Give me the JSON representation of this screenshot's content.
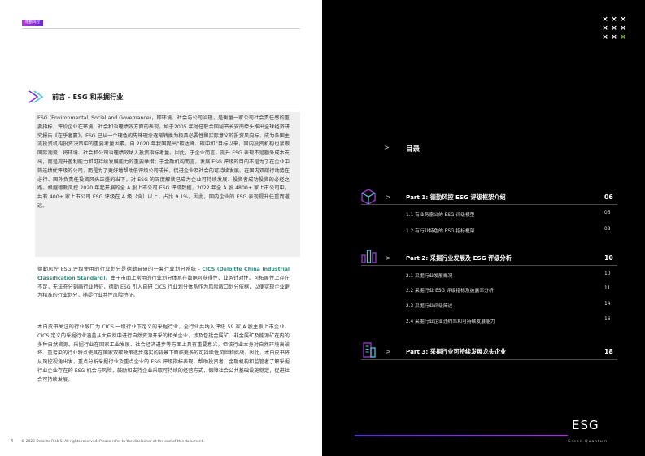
{
  "header": {
    "tag": "德勤风控"
  },
  "section": {
    "title": "前言 - ESG 和采掘行业"
  },
  "paragraphs": {
    "p1": "ESG (Environmental, Social and Governance)，即环境、社会与公司治理，是衡量一家公司社会责任感的重要指标，评价企业在环境、社会和治理绩效方面的表现。始于2005 年时任联合国秘书长安南牵头推出全球经济研究报告《在乎者赢》，ESG 已从一个瑰色的先锋理念逐渐转换为极具必要性和实际意义的投资风向标，成为各国主流投资机构投资决策中的重要考量因素。自 2020 年我国提出“碳达峰、碳中和”目标以来，国内投资机构也紧跟国际潮流，将环境、社会和公司治理绩效纳入投资指标考量。因此，于企业而言，提升 ESG 表现不是额外成本支出，而是提升盈利能力和可持续发展能力的重要举措；于金融机构而言，发展 ESG 评级的目的不是为了在企业中筛选绩优评级的公司，而是为了更好地帮助低评级公司成长，促进企业及社会的可持续发展。在国内双碳行动势在必行、国外负责任投资风头正盛的当下，对 ESG 的深度解读已成为企业可持续发展、投资者成功投资的必经之路。根据德勤风控 2020 年起开展的全 A 股上市公司 ESG 评级数据，2022 年全 A 股 4800+ 家上市公司中，共有 400+ 家上市公司 ESG 评级在 A 级（含）以上，占比 9.1%。因此，国内企业的 ESG 表现提升任重而道远。",
    "p2a": "德勤风控 ESG 评级使用的行业划分是德勤自研的一套行业划分系统 - ",
    "p2b": "CICS (Deloitte China Industrial Classification Standard)",
    "p2c": "。由于市面上常用的行业划分体系在数据可获得性、业务针对性、可拓展性上存在不足，无法充分刻画行业特征，德勤 ESG 引入自研 CICS 行业划分体系作为风险敞口划分依据，以便实现企业更为精准的行业划分，捕捉行业共性风险特征。",
    "p3": "本白皮书关注的行业敞口为 CICS 一级行业下定义的采掘行业，全行业共纳入评级 59 家 A 股主板上市企业。CICS 定义的采掘行业涵盖从大自然中进行自然资源开采的相关企业，涉及包括金属矿、非金属矿及能源矿在内的多种自然资源。采掘行业在国家工业发展、社会经济进步等方面上具有重要意义，但该行业本身对自然环境高破坏、重污染的行业特点使其在国家双碳政策逐步落实的背景下面临更多的可持续性风险和挑战。因此，本白皮书将从风控视角出发，重点分析采掘行业及重点企业的 ESG 评级指标表现，帮助投资者、金融机构和监管者了解采掘行业企业存在的 ESG 机会与风险，鼓励和支持企业采取可持续的经营方式，保障社会公共基础设施稳定，促进社会可持续发展。"
  },
  "footer": {
    "page": "4",
    "copyright": "© 2023 Deloitte Risk S. All rights reserved. Please refer to the disclaimer at the end of this document."
  },
  "toc": {
    "title": "目录",
    "parts": [
      {
        "label": "Part 1: 德勤风控 ESG 评级框架介绍",
        "page": "06",
        "subs": [
          {
            "label": "1.1 有业务意义的 ESG 评级模型",
            "page": "06"
          },
          {
            "label": "1.2 有行业特色的 ESG 指标框架",
            "page": "08"
          }
        ]
      },
      {
        "label": "Part 2: 采掘行业发展及 ESG 评级分析",
        "page": "10",
        "subs": [
          {
            "label": "2.1 采掘行业发展概况",
            "page": "10"
          },
          {
            "label": "2.2 采掘行业 ESG 评级指标及披露率分析",
            "page": "11"
          },
          {
            "label": "2.3 采掘行业评级简述",
            "page": "14"
          },
          {
            "label": "2.4 采掘行业企业违约率和可持续发展能力",
            "page": "16"
          }
        ]
      },
      {
        "label": "Part 3: 采掘行业可持续发展龙头企业",
        "page": "18",
        "subs": []
      }
    ]
  },
  "logo": {
    "main": "ESG",
    "sub": "Green Quantum"
  },
  "colors": {
    "accent_teal": "#2e8c7d",
    "accent_purple": "#7a2fd6",
    "icon_cyan": "#4fc3e8"
  }
}
